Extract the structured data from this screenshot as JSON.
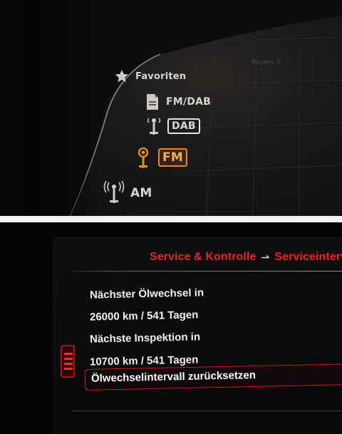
{
  "radio_menu": {
    "station_hint": "Bayern 3",
    "sources": [
      {
        "label": "Favoriten",
        "icon": "star-icon",
        "state": "plain"
      },
      {
        "label": "FM/DAB",
        "icon": "document-icon",
        "state": "plain"
      },
      {
        "label": "DAB",
        "icon": "dab-antenna-icon",
        "state": "boxed"
      },
      {
        "label": "FM",
        "icon": "fm-antenna-icon",
        "state": "active"
      },
      {
        "label": "AM",
        "icon": "am-antenna-icon",
        "state": "plain"
      }
    ],
    "accent_color": "#e08a2a"
  },
  "service_screen": {
    "breadcrumb": {
      "parent": "Service & Kontrolle",
      "separator": "⇀",
      "current": "Serviceintervalle"
    },
    "lines": [
      "Nächster Ölwechsel in",
      "26000 km / 541 Tagen",
      "Nächste Inspektion in",
      "10700 km / 541 Tagen"
    ],
    "selected_item": "Ölwechselintervall zurücksetzen",
    "accent_color": "#e02020"
  }
}
